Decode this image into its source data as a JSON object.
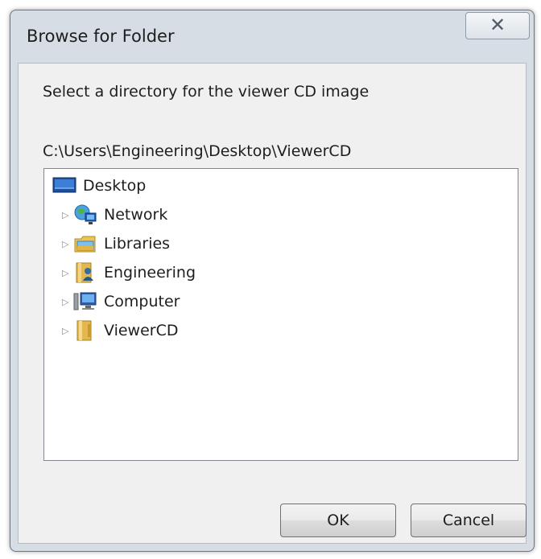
{
  "window": {
    "title": "Browse for Folder",
    "close_glyph": "✕"
  },
  "dialog": {
    "prompt": "Select a directory for the viewer CD image",
    "selected_path": "C:\\Users\\Engineering\\Desktop\\ViewerCD"
  },
  "tree": {
    "root": {
      "label": "Desktop",
      "icon": "desktop-icon"
    },
    "children": [
      {
        "label": "Network",
        "icon": "network-icon",
        "expander": "▷"
      },
      {
        "label": "Libraries",
        "icon": "libraries-icon",
        "expander": "▷"
      },
      {
        "label": "Engineering",
        "icon": "user-folder-icon",
        "expander": "▷"
      },
      {
        "label": "Computer",
        "icon": "computer-icon",
        "expander": "▷"
      },
      {
        "label": "ViewerCD",
        "icon": "folder-icon",
        "expander": "▷"
      }
    ]
  },
  "buttons": {
    "ok_label": "OK",
    "cancel_label": "Cancel"
  },
  "colors": {
    "frame": "#d6dde5",
    "client": "#f0f0f0",
    "tree_background": "#ffffff"
  }
}
